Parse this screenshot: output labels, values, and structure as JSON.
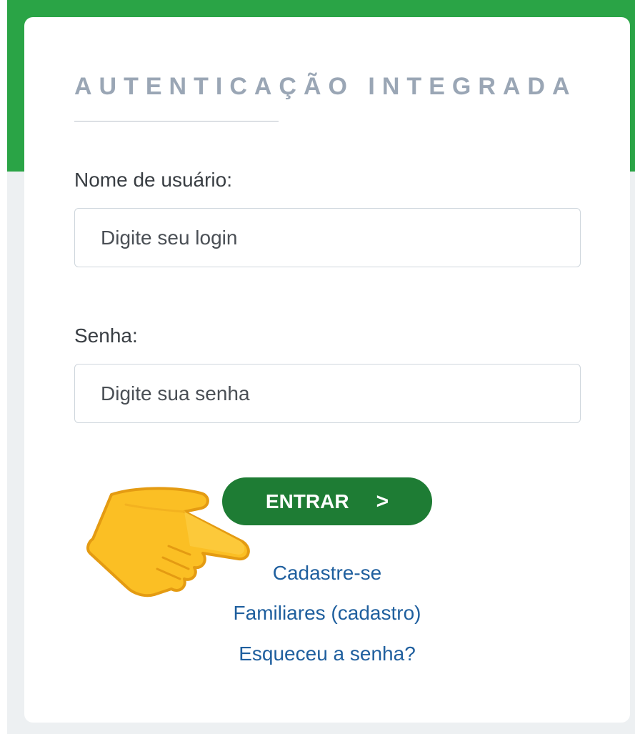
{
  "auth": {
    "title": "AUTENTICAÇÃO INTEGRADA",
    "username_label": "Nome de usuário:",
    "username_placeholder": "Digite seu login",
    "username_value": "",
    "password_label": "Senha:",
    "password_placeholder": "Digite sua senha",
    "password_value": "",
    "submit_label": "ENTRAR",
    "submit_arrow": ">"
  },
  "links": {
    "register": "Cadastre-se",
    "family_register": "Familiares (cadastro)",
    "forgot_password": "Esqueceu a senha?"
  },
  "pointer": {
    "icon": "pointing-hand-icon"
  },
  "colors": {
    "header_green": "#2aa446",
    "button_green": "#1e7c34",
    "link_blue": "#1f5f9e",
    "title_gray": "#9aa6b5",
    "page_gray": "#edf0f2",
    "hand_yellow": "#fbbf24"
  }
}
